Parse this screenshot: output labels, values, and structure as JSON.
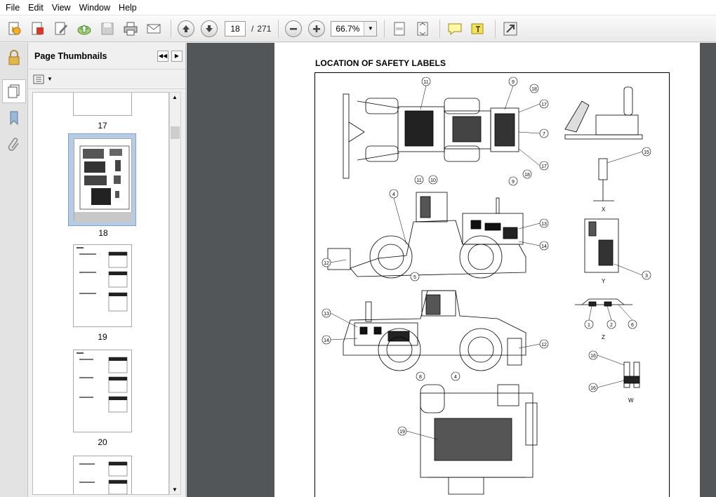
{
  "menu": [
    "File",
    "Edit",
    "View",
    "Window",
    "Help"
  ],
  "toolbar": {
    "current_page": "18",
    "page_separator": "/",
    "total_pages": "271",
    "zoom": "66.7%"
  },
  "panel": {
    "title": "Page Thumbnails",
    "thumbnails": [
      {
        "label": "17"
      },
      {
        "label": "18"
      },
      {
        "label": "19"
      },
      {
        "label": "20"
      }
    ]
  },
  "document": {
    "title": "LOCATION OF SAFETY LABELS",
    "view_captions": {
      "x": "X",
      "y": "Y",
      "z": "Z",
      "w": "W"
    },
    "callouts": [
      "1",
      "2",
      "3",
      "4",
      "5",
      "6",
      "7",
      "8",
      "9",
      "10",
      "11",
      "12",
      "13",
      "14",
      "15",
      "16",
      "17",
      "18",
      "19"
    ]
  },
  "colors": {
    "viewport_bg": "#525659",
    "selection": "#b6cbe6",
    "panel_bg": "#f0f0f0"
  },
  "icons": [
    "open-icon",
    "create-pdf-icon",
    "edit-icon",
    "upload-icon",
    "save-icon",
    "print-icon",
    "email-icon",
    "prev-page-icon",
    "next-page-icon",
    "zoom-out-icon",
    "zoom-in-icon",
    "fit-width-icon",
    "fit-page-icon",
    "comment-icon",
    "highlight-icon",
    "fullscreen-icon"
  ]
}
